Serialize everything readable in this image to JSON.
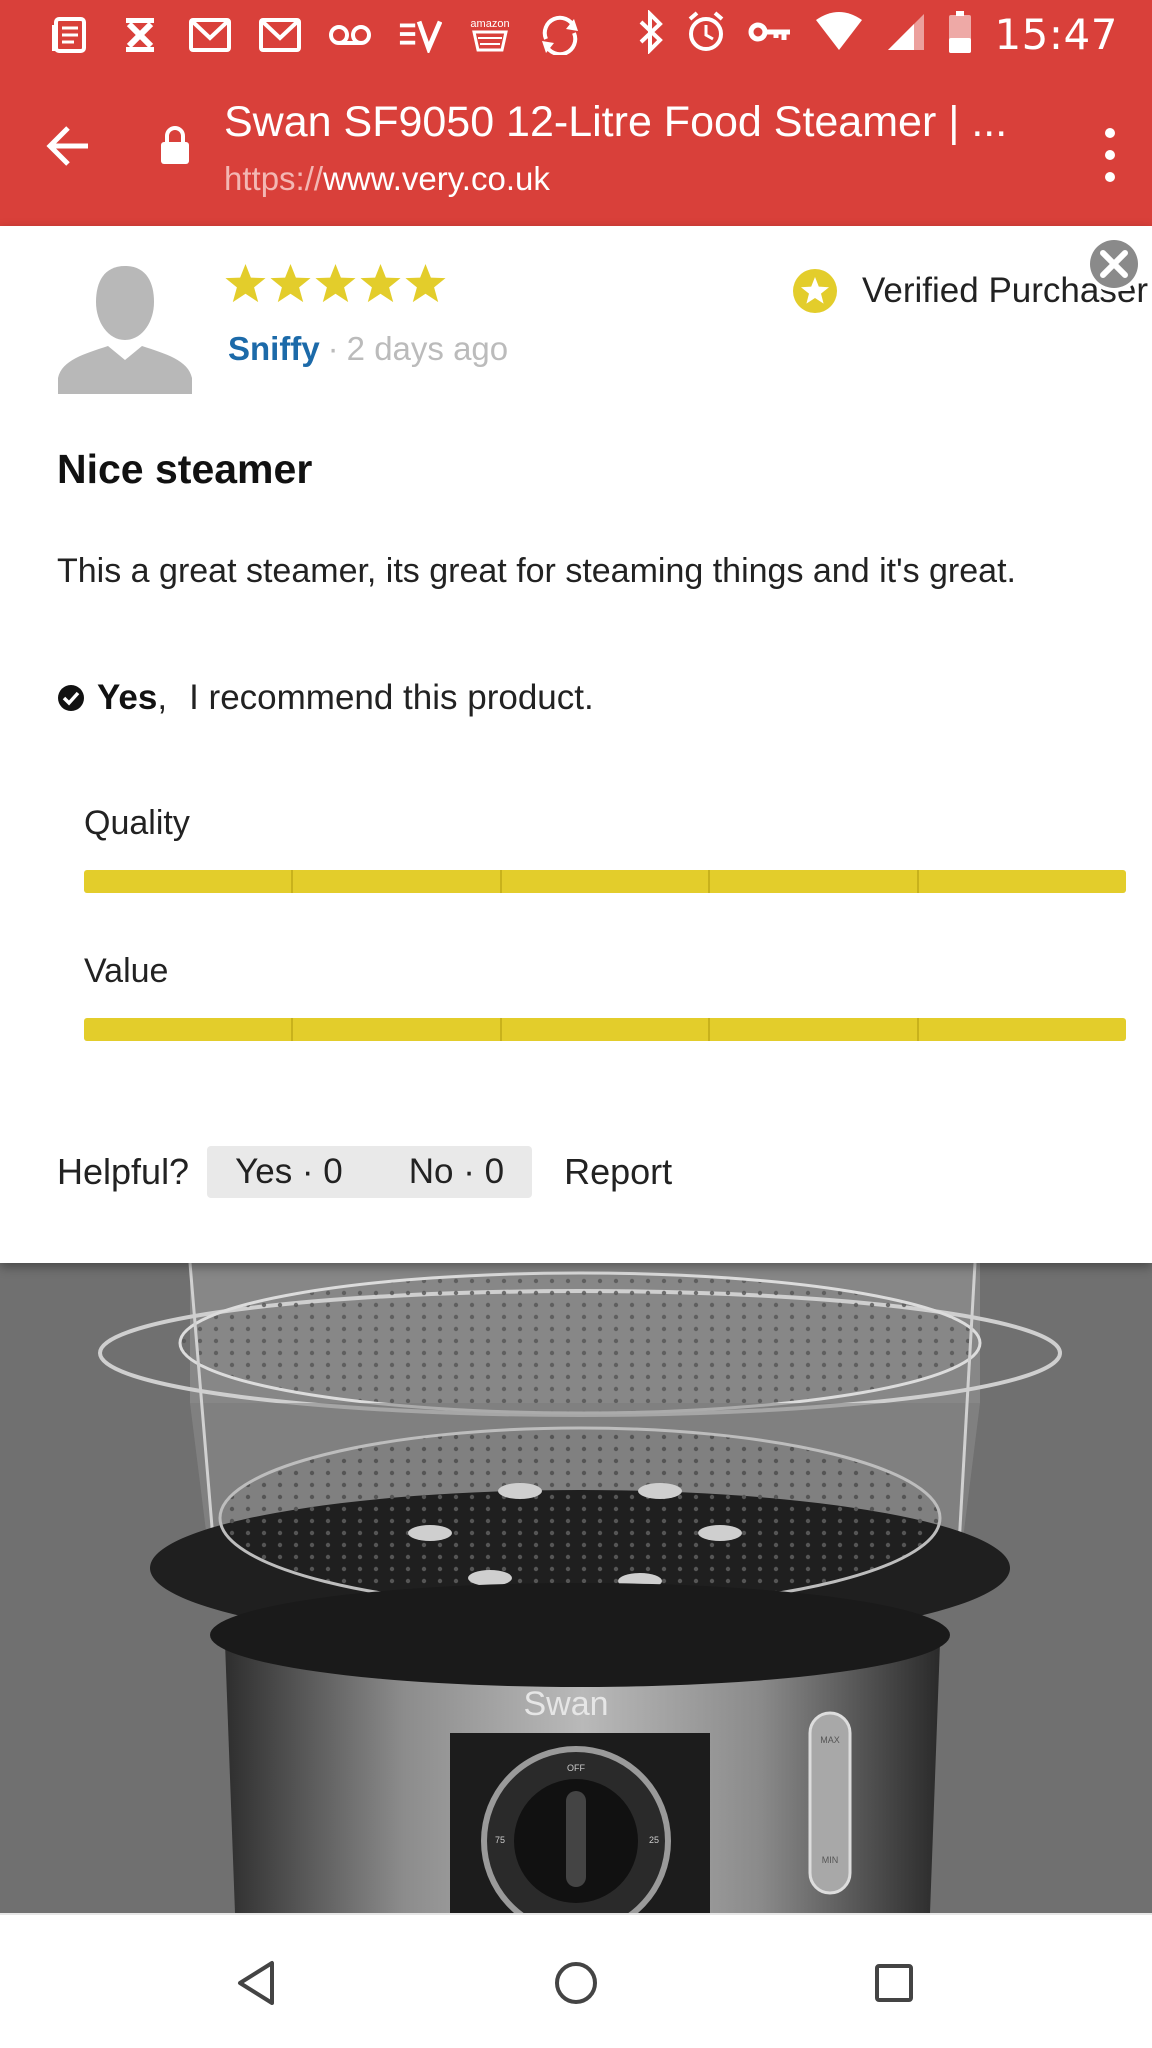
{
  "status_bar": {
    "time": "15:47",
    "left_icons": [
      "news-icon",
      "x-icon",
      "gmail-icon",
      "gmail-icon",
      "voicemail-icon",
      "evernote-icon",
      "amazon-icon",
      "sync-icon"
    ],
    "right_icons": [
      "bluetooth-icon",
      "alarm-icon",
      "vpn-key-icon",
      "wifi-icon",
      "signal-icon",
      "battery-icon"
    ],
    "amazon_text": "amazon"
  },
  "toolbar": {
    "title": "Swan SF9050 12-Litre Food Steamer | ...",
    "url_protocol": "https://",
    "url_host": "www.very.co.uk"
  },
  "review": {
    "rating": 5,
    "rating_max": 5,
    "author": "Sniffy",
    "separator": "·",
    "time_ago": "2 days ago",
    "verified_label": "Verified Purchaser",
    "title": "Nice steamer",
    "body": "This a great steamer, its great for steaming things and it's great.",
    "recommend_yes": "Yes",
    "recommend_comma": ",",
    "recommend_text": "I recommend this product.",
    "ratings": [
      {
        "label": "Quality",
        "value": 5,
        "max": 5
      },
      {
        "label": "Value",
        "value": 5,
        "max": 5
      }
    ],
    "helpful_label": "Helpful?",
    "helpful_yes": "Yes · 0",
    "helpful_no": "No · 0",
    "report_label": "Report"
  },
  "product_image": {
    "brand_text": "Swan",
    "dial_top": "OFF",
    "dial_left": "75",
    "dial_right": "25",
    "gauge_max": "MAX",
    "gauge_min": "MIN"
  },
  "colors": {
    "toolbar": "#d9403a",
    "star": "#e3cd2b",
    "author_link": "#1c6aa9",
    "bar_fill": "#e3cd2b"
  },
  "nav_bar": {
    "buttons": [
      "back-triangle-icon",
      "home-circle-icon",
      "recents-square-icon"
    ]
  }
}
